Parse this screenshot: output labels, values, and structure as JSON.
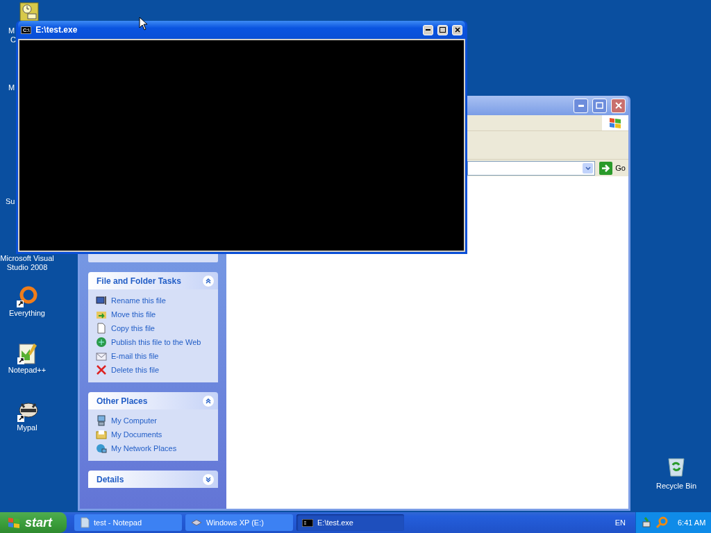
{
  "desktop_icons": [
    {
      "lines": [
        "M",
        "C"
      ]
    },
    {
      "lines": [
        "M"
      ]
    },
    {
      "lines": [
        "Su"
      ]
    },
    {
      "lines": [
        "Microsoft Visual",
        "Studio 2008"
      ]
    },
    {
      "lines": [
        "Everything"
      ]
    },
    {
      "lines": [
        "Notepad++"
      ]
    },
    {
      "lines": [
        "Mypal"
      ]
    }
  ],
  "recycle_bin": {
    "label": "Recycle Bin"
  },
  "console_window": {
    "title": "E:\\test.exe",
    "icon_text": "C:\\"
  },
  "explorer_window": {
    "address_go": "Go",
    "task_sections": [
      {
        "title": "File and Folder Tasks",
        "expanded": true,
        "items": [
          {
            "label": "Rename this file"
          },
          {
            "label": "Move this file"
          },
          {
            "label": "Copy this file"
          },
          {
            "label": "Publish this file to the Web"
          },
          {
            "label": "E-mail this file"
          },
          {
            "label": "Delete this file"
          }
        ]
      },
      {
        "title": "Other Places",
        "expanded": true,
        "items": [
          {
            "label": "My Computer"
          },
          {
            "label": "My Documents"
          },
          {
            "label": "My Network Places"
          }
        ]
      },
      {
        "title": "Details",
        "expanded": false
      }
    ]
  },
  "taskbar": {
    "start": "start",
    "tasks": [
      {
        "label": "test - Notepad",
        "selected": false
      },
      {
        "label": "Windows XP (E:)",
        "selected": false
      },
      {
        "label": "E:\\test.exe",
        "selected": true
      }
    ],
    "language": "EN",
    "clock": "6:41 AM"
  }
}
